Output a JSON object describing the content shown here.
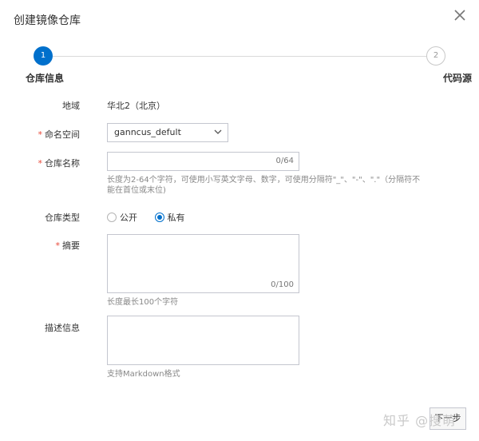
{
  "dialog": {
    "title": "创建镜像仓库"
  },
  "steps": [
    {
      "number": "1",
      "label": "仓库信息",
      "state": "active"
    },
    {
      "number": "2",
      "label": "代码源",
      "state": "inactive"
    }
  ],
  "form": {
    "region": {
      "label": "地域",
      "value": "华北2（北京）"
    },
    "namespace": {
      "required": "*",
      "label": "命名空间",
      "value": "ganncus_defult"
    },
    "repo_name": {
      "required": "*",
      "label": "仓库名称",
      "value": "",
      "counter": "0/64",
      "hint": "长度为2-64个字符，可使用小写英文字母、数字，可使用分隔符\"_\"、\"-\"、\".\"（分隔符不能在首位或末位)"
    },
    "repo_type": {
      "label": "仓库类型",
      "options": [
        {
          "label": "公开",
          "checked": false
        },
        {
          "label": "私有",
          "checked": true
        }
      ]
    },
    "summary": {
      "required": "*",
      "label": "摘要",
      "value": "",
      "counter": "0/100",
      "hint": "长度最长100个字符"
    },
    "description": {
      "label": "描述信息",
      "value": "",
      "hint": "支持Markdown格式"
    }
  },
  "footer": {
    "watermark": "知乎 @搜萌",
    "next_label": "下一步"
  },
  "colors": {
    "accent": "#0070cc",
    "required": "#e84738",
    "border": "#c4c6cf"
  },
  "icons": {
    "close": "close-icon",
    "dropdown": "chevron-down-icon"
  }
}
